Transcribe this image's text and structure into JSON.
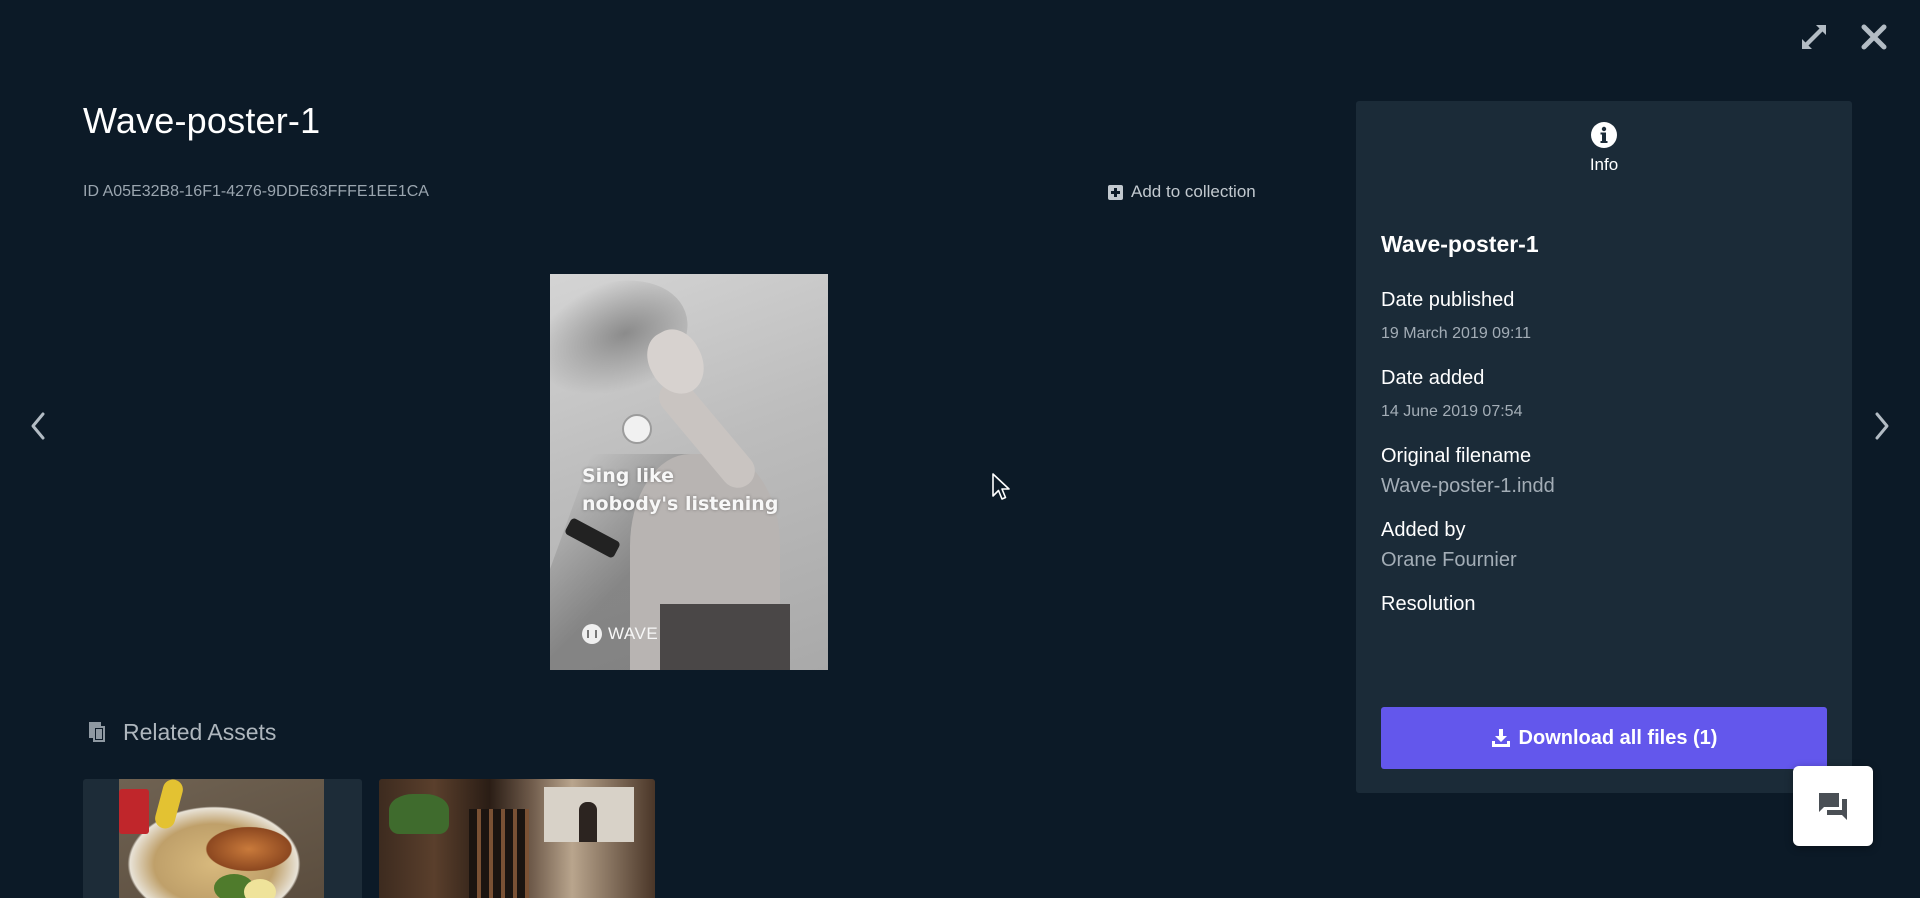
{
  "asset": {
    "title": "Wave-poster-1",
    "id_text": "ID A05E32B8-16F1-4276-9DDE63FFFE1EE1CA",
    "add_to_collection_label": "Add to collection"
  },
  "poster": {
    "tagline_line1": "Sing like",
    "tagline_line2": "nobody's listening",
    "brand": "WAVE"
  },
  "related": {
    "header": "Related Assets"
  },
  "info_panel": {
    "tab_label": "Info",
    "title": "Wave-poster-1",
    "fields": [
      {
        "label": "Date published",
        "value": "19 March 2019 09:11"
      },
      {
        "label": "Date added",
        "value": "14 June 2019 07:54"
      },
      {
        "label": "Original filename",
        "value": "Wave-poster-1.indd"
      },
      {
        "label": "Added by",
        "value": "Orane Fournier"
      },
      {
        "label": "Resolution",
        "value": ""
      }
    ],
    "download_label": "Download all files (1)"
  },
  "icons": {
    "expand": "expand-icon",
    "close": "close-icon",
    "prev": "chevron-left-icon",
    "next": "chevron-right-icon",
    "info": "info-icon",
    "download": "download-icon",
    "chat": "chat-icon",
    "related": "copy-files-icon"
  },
  "colors": {
    "background": "#0c1a27",
    "panel": "#1b2b38",
    "accent": "#6357ec",
    "muted_text": "#a3adb6"
  }
}
